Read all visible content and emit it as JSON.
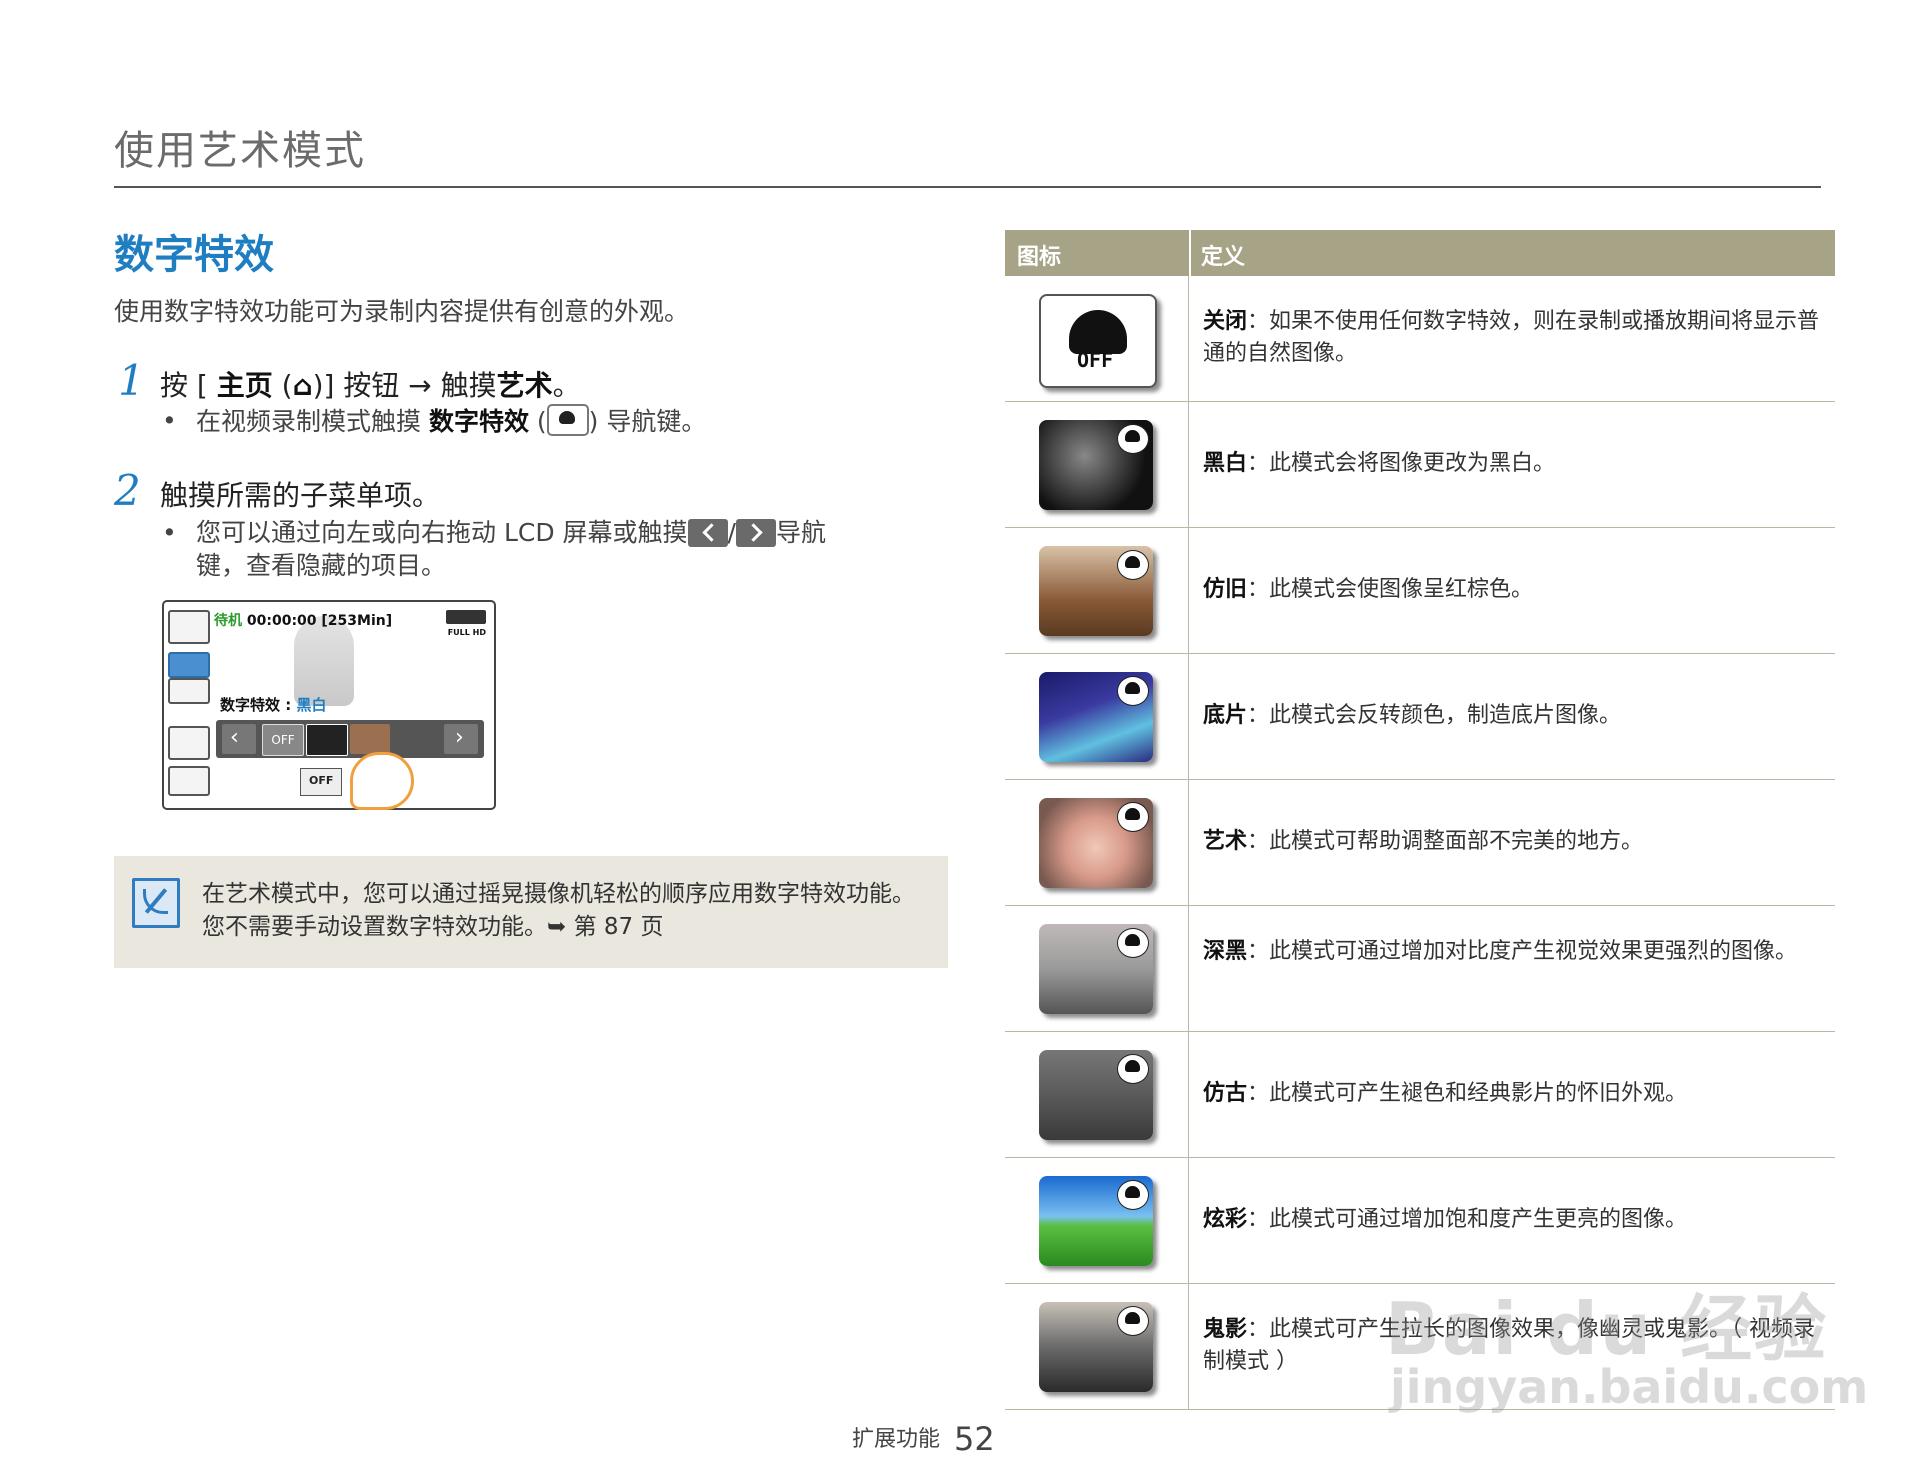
{
  "header": {
    "title": "使用艺术模式"
  },
  "section": {
    "title": "数字特效",
    "intro": "使用数字特效功能可为录制内容提供有创意的外观。"
  },
  "steps": [
    {
      "num": "1",
      "text_a": "按 [ ",
      "bold_a": "主页",
      "text_b": " (",
      "home_glyph": "⌂",
      "text_c": ")] 按钮 → 触摸",
      "bold_b": "艺术",
      "text_d": "。",
      "bullet_a": "在视频录制模式触摸 ",
      "bullet_bold": "数字特效",
      "bullet_b": " (",
      "bullet_c": ") 导航键。"
    },
    {
      "num": "2",
      "text": "触摸所需的子菜单项。",
      "bullet_a": "您可以通过向左或向右拖动 LCD 屏幕或触摸",
      "bullet_slash": "/",
      "bullet_b": "导航",
      "bullet_c": "键，查看隐藏的项目。"
    }
  ],
  "lcd": {
    "status_green": "待机",
    "status_time": " 00:00:00 [253Min]",
    "full_hd": "FULL HD",
    "label": "数字特效 : ",
    "label_value": "黑白",
    "off_cell": "OFF",
    "bottom_off": "OFF"
  },
  "note": {
    "line1": "在艺术模式中，您可以通过摇晃摄像机轻松的顺序应用数字特效功能。",
    "line2": "您不需要手动设置数字特效功能。➥ 第 87 页"
  },
  "table": {
    "col_icon": "图标",
    "col_def": "定义",
    "off_icon_text": "OFF",
    "rows": [
      {
        "term": "关闭",
        "sep": "：",
        "def": "如果不使用任何数字特效，则在录制或播放期间将显示普通的自然图像。",
        "icon": "off-icon",
        "color": "#ffffff"
      },
      {
        "term": "黑白",
        "sep": "：",
        "def": "此模式会将图像更改为黑白。",
        "icon": "bw-thumbnail",
        "color": "#2a2a2a"
      },
      {
        "term": "仿旧",
        "sep": "：",
        "def": "此模式会使图像呈红棕色。",
        "icon": "sepia-thumbnail",
        "color": "#8a5a38"
      },
      {
        "term": "底片",
        "sep": "：",
        "def": "此模式会反转颜色，制造底片图像。",
        "icon": "negative-thumbnail",
        "color": "#3a3aa0"
      },
      {
        "term": "艺术",
        "sep": "：",
        "def": "此模式可帮助调整面部不完美的地方。",
        "icon": "art-thumbnail",
        "color": "#d89a8a"
      },
      {
        "term": "深黑",
        "sep": "：",
        "def": "此模式可通过增加对比度产生视觉效果更强烈的图像。",
        "icon": "noir-thumbnail",
        "color": "#9a9a9a"
      },
      {
        "term": "仿古",
        "sep": "：",
        "def": "此模式可产生褪色和经典影片的怀旧外观。",
        "icon": "old-film-thumbnail",
        "color": "#5a5a5a"
      },
      {
        "term": "炫彩",
        "sep": "：",
        "def": "此模式可通过增加饱和度产生更亮的图像。",
        "icon": "dazzle-thumbnail",
        "color": "#3aa0e0"
      },
      {
        "term": "鬼影",
        "sep": "：",
        "def": "此模式可产生拉长的图像效果，像幽灵或鬼影。（ 视频录制模式 ）",
        "icon": "ghost-thumbnail",
        "color": "#4a4a4a"
      }
    ]
  },
  "footer": {
    "label": "扩展功能",
    "page": "52"
  },
  "watermark": {
    "main": "Bai du 经验",
    "url": "jingyan.baidu.com"
  }
}
